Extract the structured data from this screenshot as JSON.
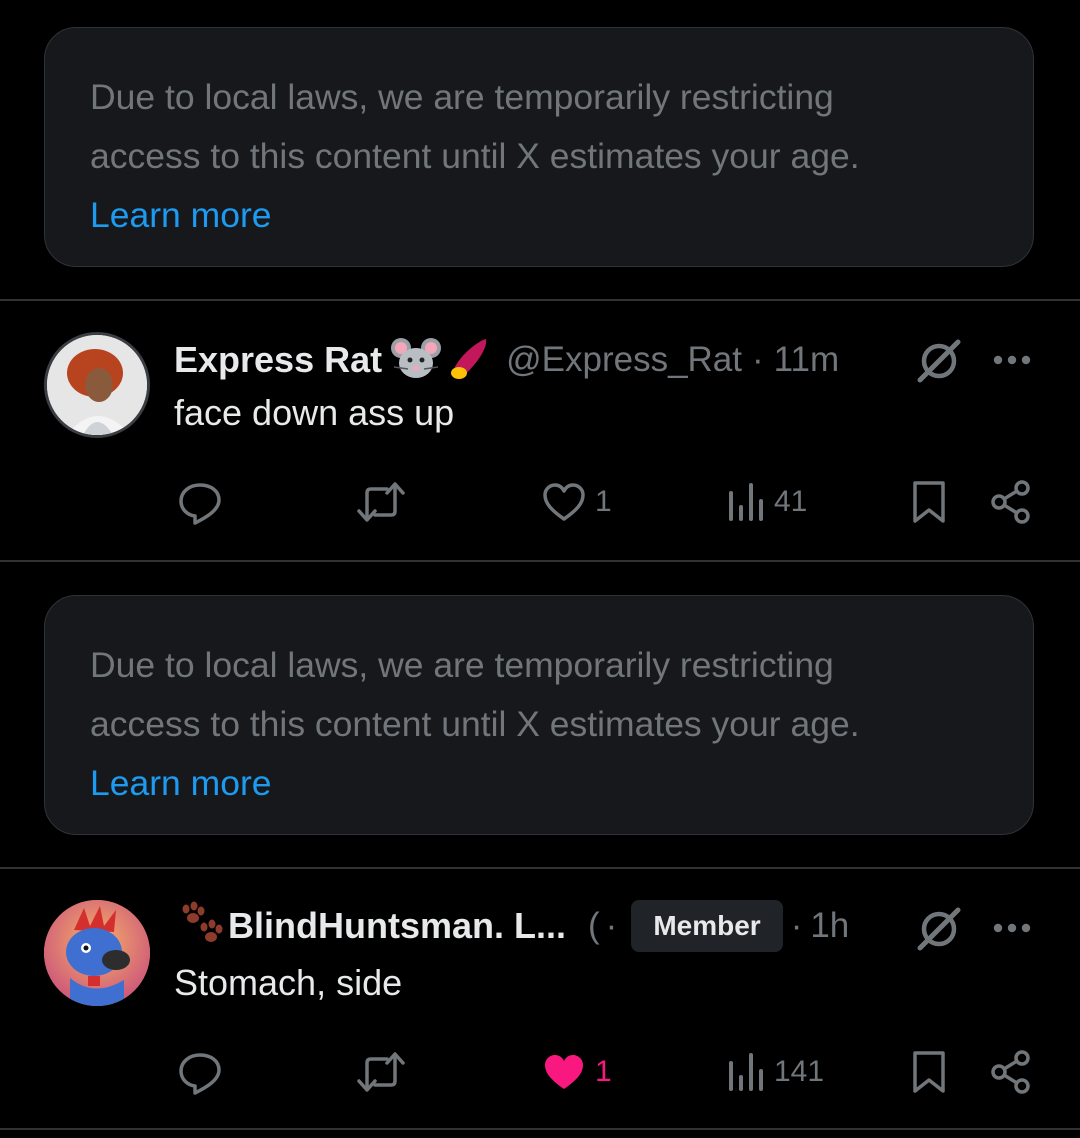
{
  "notices": [
    {
      "line1": "Due to local laws, we are temporarily restricting",
      "line2": "access to this content until X estimates your age.",
      "link": "Learn more"
    },
    {
      "line1": "Due to local laws, we are temporarily restricting",
      "line2": "access to this content until X estimates your age.",
      "link": "Learn more"
    }
  ],
  "posts": [
    {
      "display_name": "Express Rat",
      "name_emojis": [
        "mouse-face-icon",
        "sweet-potato-icon"
      ],
      "handle": "@Express_Rat",
      "separator": "·",
      "time": "11m",
      "text": "face down ass up",
      "likes": "1",
      "liked": false,
      "views": "41"
    },
    {
      "name_prefix_icon": "paw-prints-icon",
      "display_name": "BlindHuntsman. L...",
      "handle_fragment": "(",
      "separator": "·",
      "badge": "Member",
      "separator2": "·",
      "time": "1h",
      "text": "Stomach, side",
      "likes": "1",
      "liked": true,
      "views": "141"
    }
  ],
  "colors": {
    "background": "#000000",
    "card": "#16181c",
    "border": "#2f3336",
    "primary_text": "#e7e9ea",
    "secondary_text": "#71767b",
    "link": "#1d9bf0",
    "like_active": "#f91880"
  }
}
